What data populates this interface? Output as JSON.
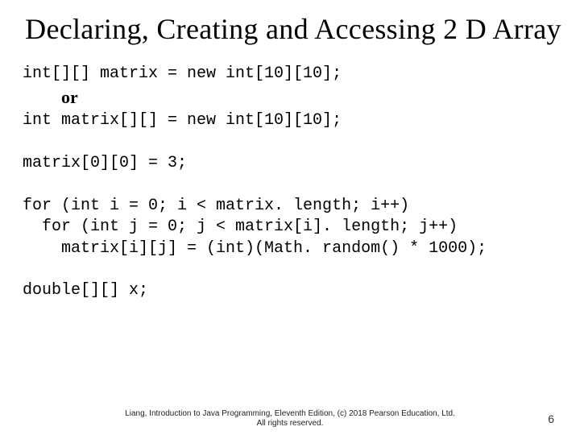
{
  "title": "Declaring, Creating and Accessing 2 D Array",
  "code": {
    "l1": "int[][] matrix = new int[10][10];",
    "or": "or",
    "l2": "int matrix[][] = new int[10][10];",
    "l3": "matrix[0][0] = 3;",
    "l4": "for (int i = 0; i < matrix. length; i++)",
    "l5": "  for (int j = 0; j < matrix[i]. length; j++)",
    "l6": "    matrix[i][j] = (int)(Math. random() * 1000);",
    "l7": "double[][] x;"
  },
  "footer": {
    "line1": "Liang, Introduction to Java Programming, Eleventh Edition, (c) 2018 Pearson Education, Ltd.",
    "line2": "All rights reserved."
  },
  "page_number": "6"
}
